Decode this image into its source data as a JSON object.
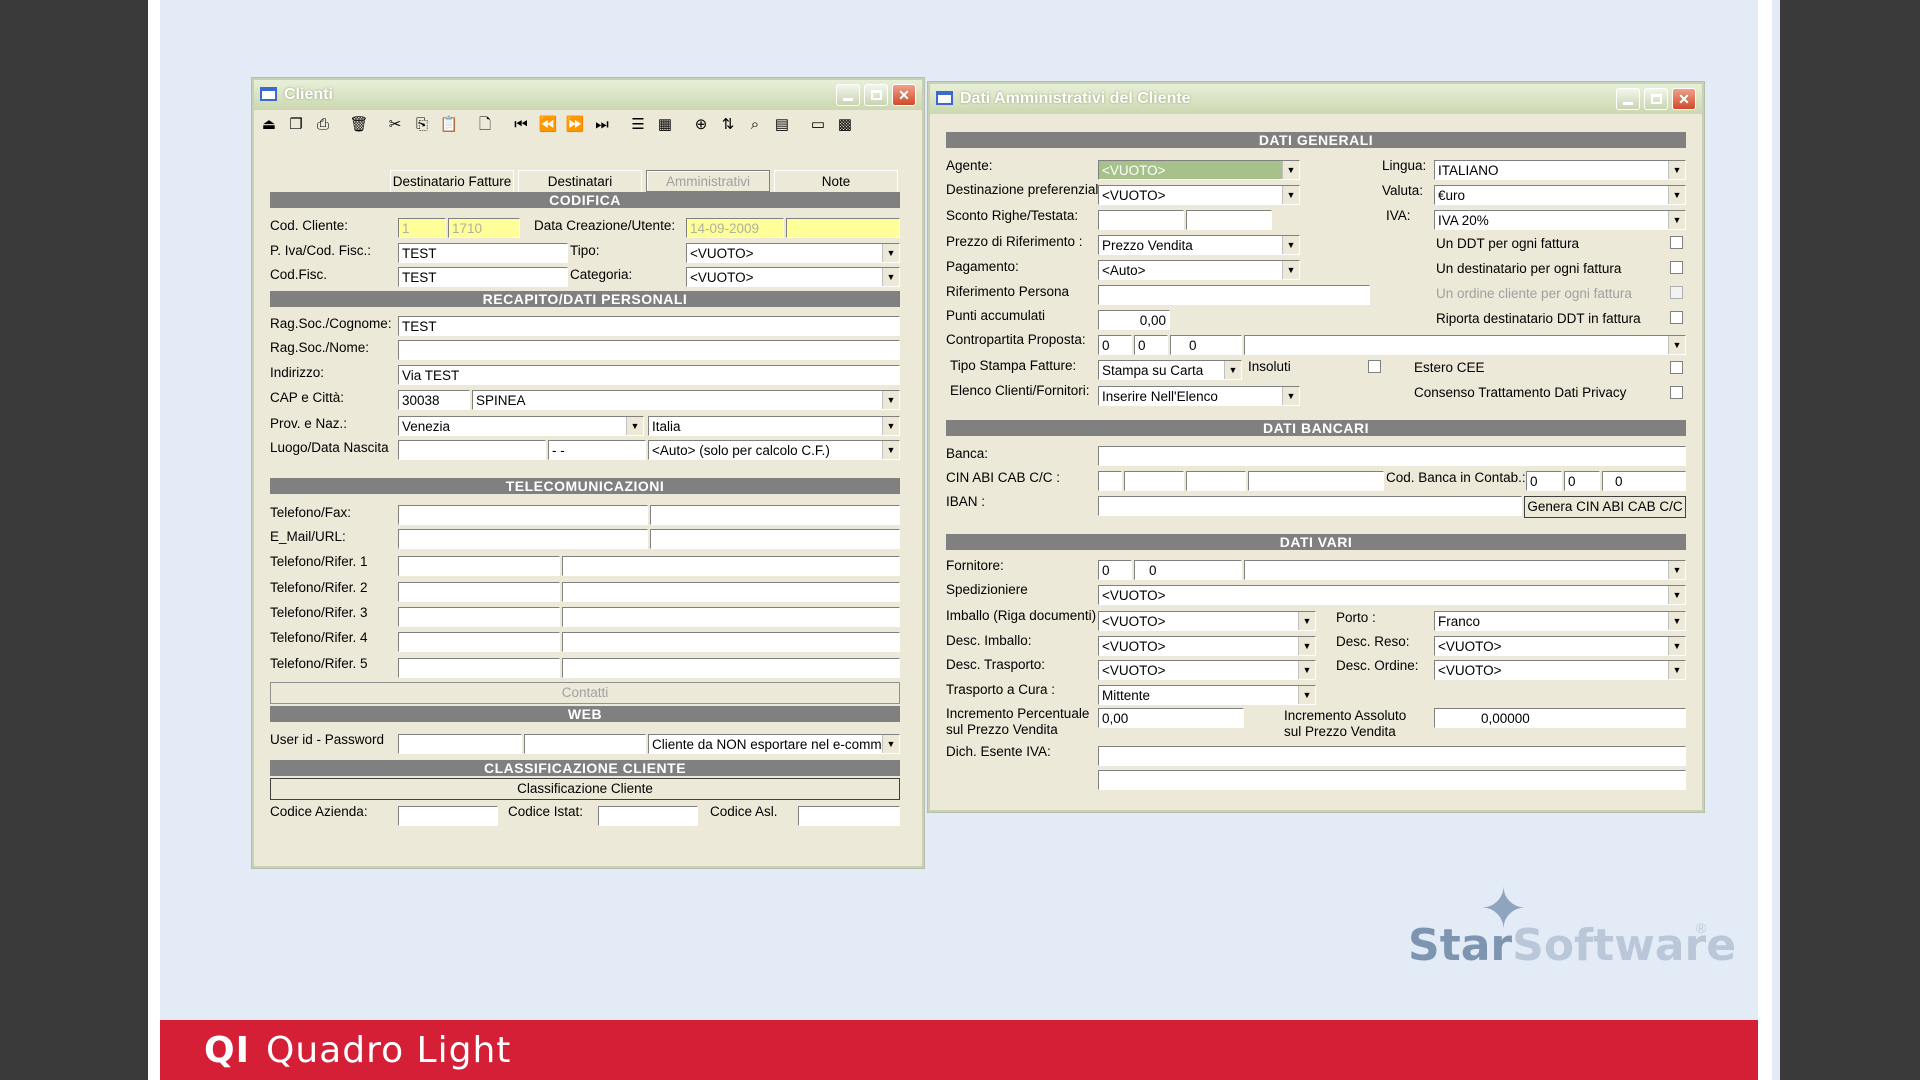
{
  "footer": {
    "logo_mark": "QI",
    "product": "Quadro Light"
  },
  "brand": {
    "part1": "Star",
    "part2": "Software",
    "reg": "®",
    "accent": "#d41f36"
  },
  "clienti": {
    "title": "Clienti",
    "tabs": [
      "Destinatario Fatture",
      "Destinatari",
      "Amministrativi",
      "Note"
    ],
    "sections": {
      "codifica": "CODIFICA",
      "recapito": "RECAPITO/DATI PERSONALI",
      "telecom": "TELECOMUNICAZIONI",
      "web": "WEB",
      "classif": "CLASSIFICAZIONE CLIENTE"
    },
    "labels": {
      "cod_cliente": "Cod. Cliente:",
      "data_creazione": "Data Creazione/Utente:",
      "piva": "P. Iva/Cod. Fisc.:",
      "tipo": "Tipo:",
      "codfisc": "Cod.Fisc.",
      "categoria": "Categoria:",
      "ragsoc_cognome": "Rag.Soc./Cognome:",
      "ragsoc_nome": "Rag.Soc./Nome:",
      "indirizzo": "Indirizzo:",
      "cap_citta": "CAP e Città:",
      "prov_naz": "Prov. e Naz.:",
      "luogo_data": "Luogo/Data Nascita",
      "tel_fax": "Telefono/Fax:",
      "email_url": "E_Mail/URL:",
      "rifer1": "Telefono/Rifer. 1",
      "rifer2": "Telefono/Rifer. 2",
      "rifer3": "Telefono/Rifer. 3",
      "rifer4": "Telefono/Rifer. 4",
      "rifer5": "Telefono/Rifer. 5",
      "userid": "User id - Password",
      "cod_azienda": "Codice Azienda:",
      "cod_istat": "Codice Istat:",
      "cod_asl": "Codice Asl."
    },
    "values": {
      "cod1": "1",
      "cod2": "1710",
      "data": "14-09-2009",
      "piva": "TEST",
      "tipo": "<VUOTO>",
      "codfisc": "TEST",
      "categoria": "<VUOTO>",
      "ragsoc_cognome": "TEST",
      "indirizzo": "Via TEST",
      "cap": "30038",
      "citta": "SPINEA",
      "prov": "Venezia",
      "naz": "Italia",
      "data_nascita": "- -",
      "auto_cf": "<Auto> (solo per calcolo C.F.)",
      "export": "Cliente da NON esportare nel e-comm"
    },
    "buttons": {
      "contatti": "Contatti",
      "classificazione": "Classificazione Cliente"
    }
  },
  "admin": {
    "title": "Dati Amministrativi del Cliente",
    "sections": {
      "generali": "DATI GENERALI",
      "bancari": "DATI BANCARI",
      "vari": "DATI VARI"
    },
    "labels": {
      "agente": "Agente:",
      "destinazione": "Destinazione preferenziale",
      "sconto": "Sconto Righe/Testata:",
      "prezzo_rif": "Prezzo di Riferimento :",
      "pagamento": "Pagamento:",
      "rif_persona": "Riferimento Persona",
      "punti": "Punti accumulati",
      "contropartita": "Contropartita Proposta:",
      "tipo_stampa": "Tipo Stampa Fatture:",
      "insoluti": "Insoluti",
      "elenco": "Elenco Clienti/Fornitori:",
      "lingua": "Lingua:",
      "valuta": "Valuta:",
      "iva": "IVA:",
      "ddt_fattura": "Un DDT per ogni fattura",
      "dest_fattura": "Un destinatario per ogni fattura",
      "ordine_fattura": "Un ordine cliente per ogni fattura",
      "riporta_ddt": "Riporta destinatario DDT in fattura",
      "estero": "Estero CEE",
      "privacy": "Consenso Trattamento Dati Privacy",
      "banca": "Banca:",
      "cin": "CIN ABI CAB C/C :",
      "iban": "IBAN :",
      "cod_banca": "Cod. Banca in Contab.:",
      "fornitore": "Fornitore:",
      "spedizioniere": "Spedizioniere",
      "imballo": "Imballo (Riga documenti)",
      "desc_imballo": "Desc. Imballo:",
      "desc_trasporto": "Desc. Trasporto:",
      "trasporto_cura": "Trasporto a Cura :",
      "incr_perc": "Incremento Percentuale",
      "incr_perc2": "sul Prezzo Vendita",
      "incr_ass": "Incremento Assoluto",
      "incr_ass2": "sul Prezzo Vendita",
      "porto": "Porto :",
      "desc_reso": "Desc. Reso:",
      "desc_ordine": "Desc. Ordine:",
      "dich_iva": "Dich. Esente IVA:"
    },
    "values": {
      "agente": "<VUOTO>",
      "destinazione": "<VUOTO>",
      "prezzo_rif": "Prezzo Vendita",
      "pagamento": "<Auto>",
      "punti": "0,00",
      "contro1": "0",
      "contro2": "0",
      "contro3": "0",
      "tipo_stampa": "Stampa su Carta",
      "elenco": "Inserire Nell'Elenco",
      "lingua": "ITALIANO",
      "valuta": "€uro",
      "iva": "IVA 20%",
      "codb1": "0",
      "codb2": "0",
      "codb3": "0",
      "forn1": "0",
      "forn2": "0",
      "spedizioniere": "<VUOTO>",
      "imballo": "<VUOTO>",
      "desc_imballo": "<VUOTO>",
      "desc_trasporto": "<VUOTO>",
      "trasporto_cura": "Mittente",
      "incr_perc": "0,00",
      "incr_ass": "0,00000",
      "porto": "Franco",
      "desc_reso": "<VUOTO>",
      "desc_ordine": "<VUOTO>"
    },
    "buttons": {
      "genera": "Genera CIN ABI CAB C/C"
    }
  }
}
